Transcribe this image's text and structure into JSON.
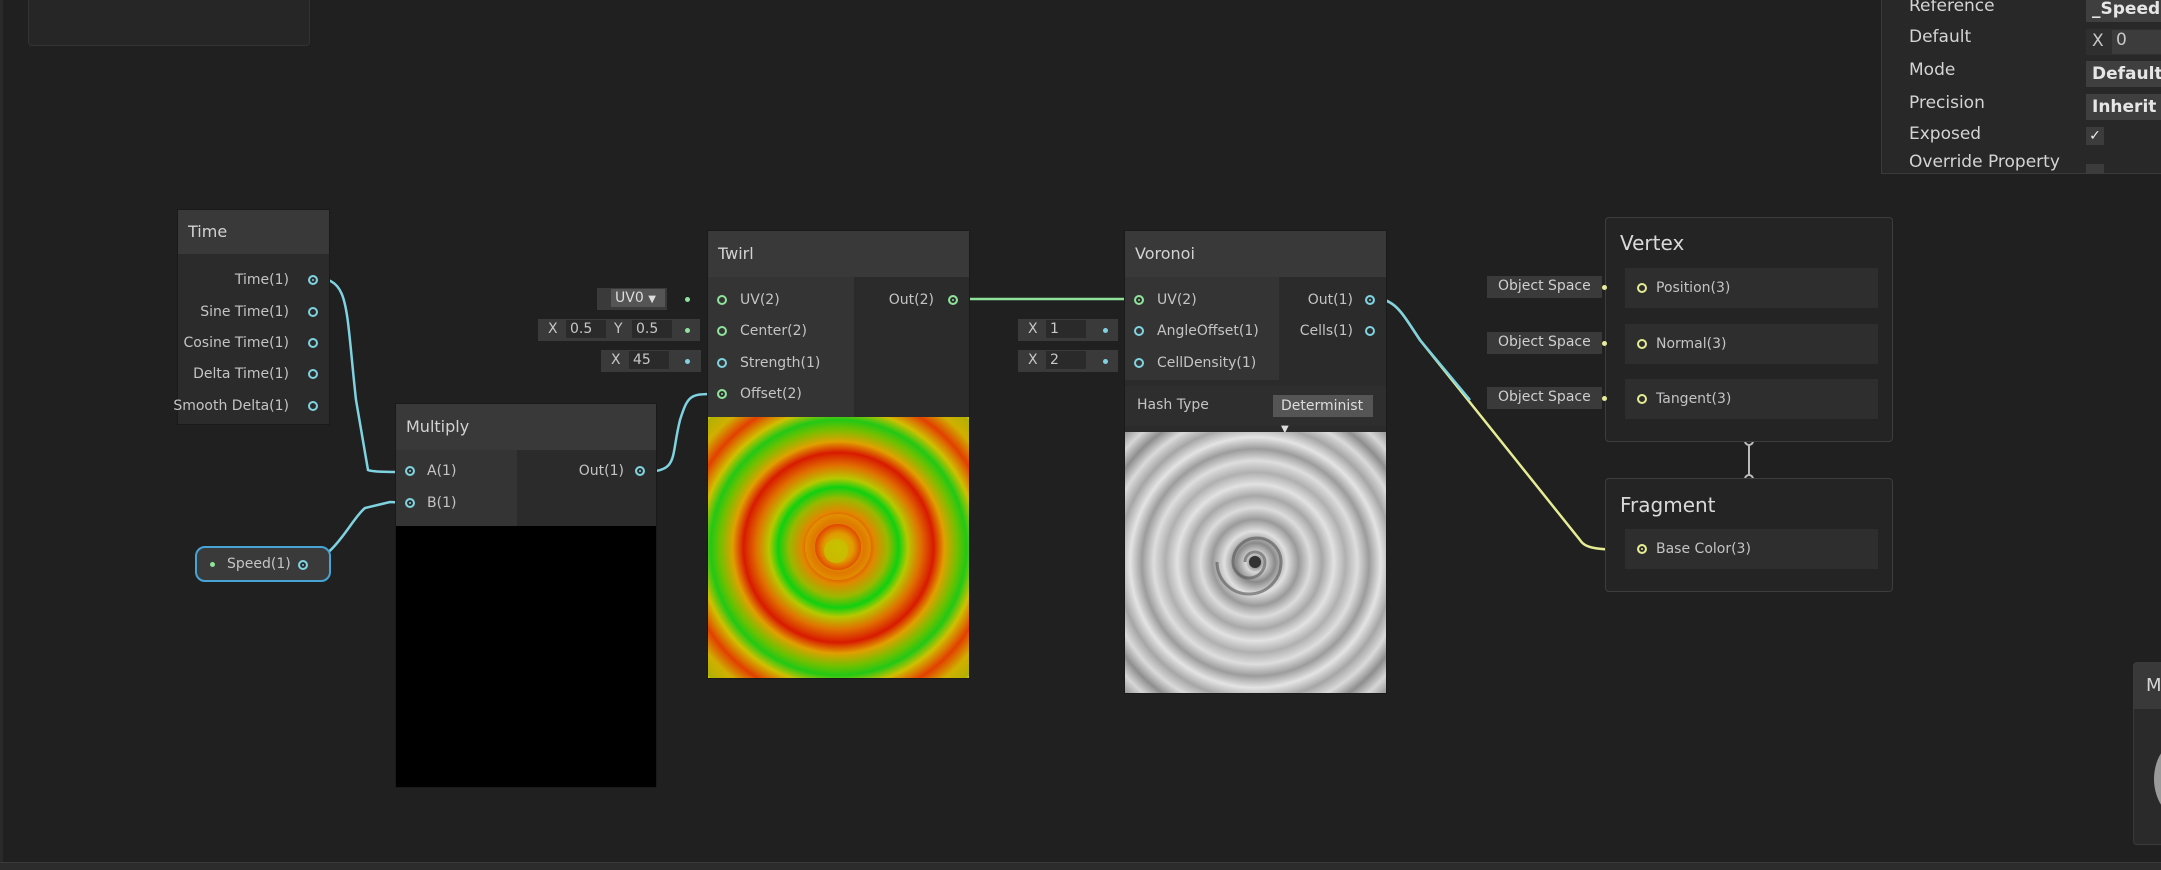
{
  "nodes": {
    "time": {
      "title": "Time",
      "outputs": [
        "Time(1)",
        "Sine Time(1)",
        "Cosine Time(1)",
        "Delta Time(1)",
        "Smooth Delta(1)"
      ]
    },
    "multiply": {
      "title": "Multiply",
      "inputs": [
        "A(1)",
        "B(1)"
      ],
      "output": "Out(1)"
    },
    "speed": {
      "label": "Speed(1)"
    },
    "twirl": {
      "title": "Twirl",
      "inputs": [
        "UV(2)",
        "Center(2)",
        "Strength(1)",
        "Offset(2)"
      ],
      "output": "Out(2)",
      "uv_dropdown": "UV0",
      "center_x_label": "X",
      "center_x": "0.5",
      "center_y_label": "Y",
      "center_y": "0.5",
      "strength_label": "X",
      "strength": "45"
    },
    "voronoi": {
      "title": "Voronoi",
      "inputs": [
        "UV(2)",
        "AngleOffset(1)",
        "CellDensity(1)"
      ],
      "outputs": [
        "Out(1)",
        "Cells(1)"
      ],
      "angle_label": "X",
      "angle": "1",
      "density_label": "X",
      "density": "2",
      "hash_type_label": "Hash Type",
      "hash_type_value": "Determinist"
    }
  },
  "master": {
    "vertex": {
      "title": "Vertex",
      "slots": [
        "Position(3)",
        "Normal(3)",
        "Tangent(3)"
      ],
      "space_label": "Object Space"
    },
    "fragment": {
      "title": "Fragment",
      "slots": [
        "Base Color(3)"
      ]
    }
  },
  "inspector": {
    "reference_label": "Reference",
    "reference_value": "_Speed",
    "default_label": "Default",
    "default_x": "X",
    "default_value": "0",
    "mode_label": "Mode",
    "mode_value": "Default",
    "precision_label": "Precision",
    "precision_value": "Inherit",
    "exposed_label": "Exposed",
    "exposed_checked": true,
    "override_label": "Override Property"
  },
  "preview_corner_label": "M",
  "colors": {
    "background": "#202020",
    "port_float": "#7fd3e0",
    "port_vector2": "#8fe29a",
    "port_vector3": "#e6ec93",
    "selection": "#46a4d6"
  }
}
